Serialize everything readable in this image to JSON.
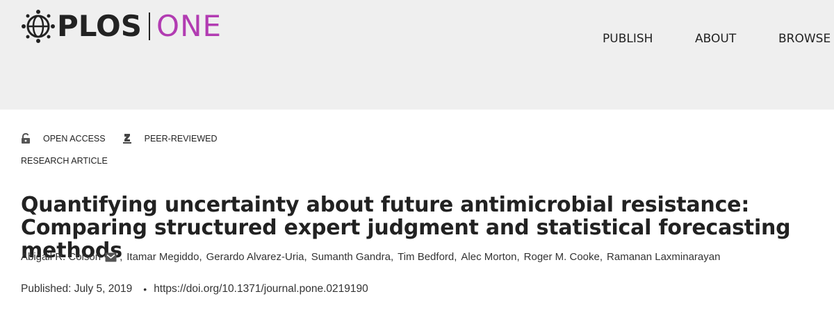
{
  "logo": {
    "plos": "PLOS",
    "one": "ONE"
  },
  "nav": {
    "publish": "PUBLISH",
    "about": "ABOUT",
    "browse": "BROWSE"
  },
  "badges": {
    "open_access": "OPEN ACCESS",
    "peer_reviewed": "PEER-REVIEWED"
  },
  "article_type": "RESEARCH ARTICLE",
  "title": "Quantifying uncertainty about future antimicrobial resistance: Comparing structured expert judgment and statistical forecasting methods",
  "authors": [
    "Abigail R. Colson",
    "Itamar Megiddo",
    "Gerardo Alvarez-Uria",
    "Sumanth Gandra",
    "Tim Bedford",
    "Alec Morton",
    "Roger M. Cooke",
    "Ramanan Laxminarayan"
  ],
  "published": "Published: July 5, 2019",
  "doi": "https://doi.org/10.1371/journal.pone.0219190",
  "colors": {
    "header_bg": "#efefef",
    "one_accent": "#b23cb2",
    "text": "#222222"
  }
}
